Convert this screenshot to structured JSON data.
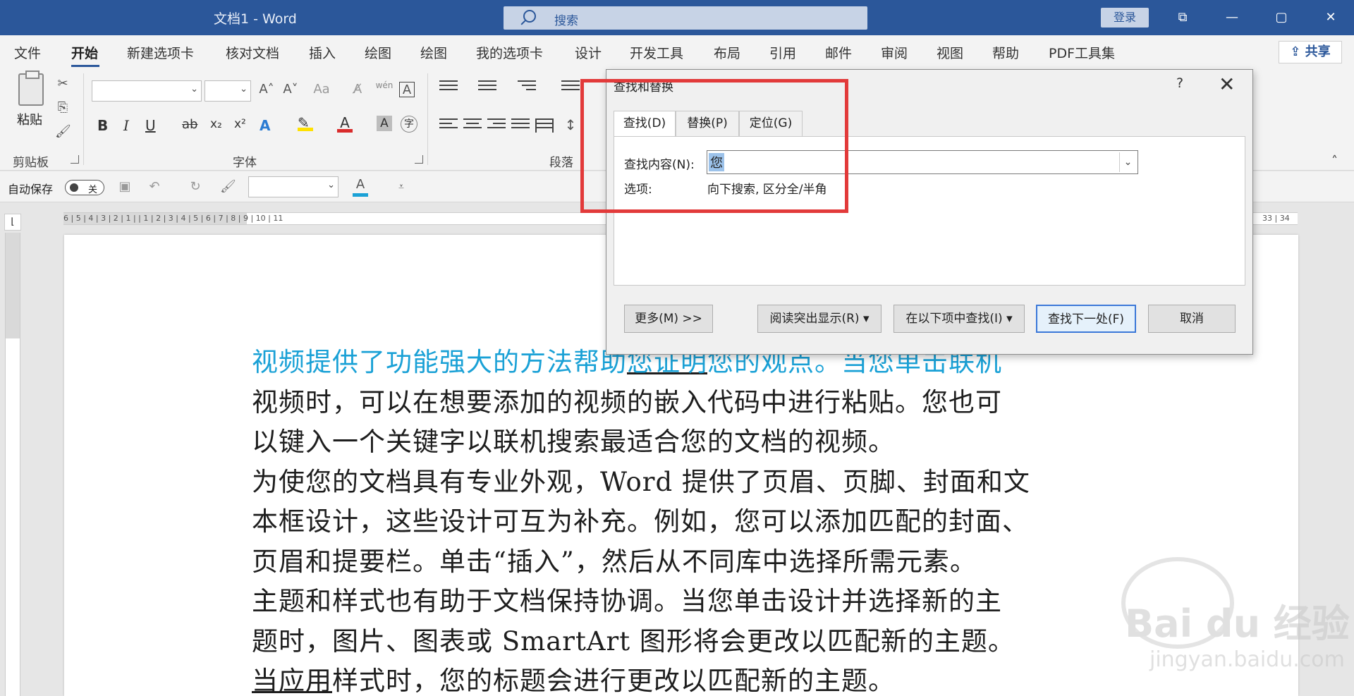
{
  "titlebar": {
    "title": "文档1  -  Word",
    "search_placeholder": "搜索",
    "login": "登录",
    "restore_label": "⧉",
    "minimize_label": "—",
    "maximize_label": "▢",
    "close_label": "✕"
  },
  "menu": {
    "items": [
      "文件",
      "开始",
      "新建选项卡",
      "核对文档",
      "插入",
      "绘图",
      "绘图",
      "我的选项卡",
      "设计",
      "开发工具",
      "布局",
      "引用",
      "邮件",
      "审阅",
      "视图",
      "帮助",
      "PDF工具集"
    ],
    "share": "共享"
  },
  "ribbon": {
    "paste_label": "粘贴",
    "clipboard_label": "剪贴板",
    "font_label": "字体",
    "paragraph_label": "段落",
    "bold": "B",
    "italic": "I",
    "underline": "U",
    "strike": "ab",
    "subscript": "x₂",
    "superscript": "x²",
    "font_color": "A",
    "grow": "A˄",
    "shrink": "A˅",
    "case": "Aa",
    "wen": "wén"
  },
  "qat": {
    "autosave": "自动保存",
    "toggle_state": "关"
  },
  "ruler": {
    "numbers": "6  |  5  |  4  |  3  |  2  |  1  |     |  1  |  2  |  3  |  4  |  5  |  6  |  7  |  8  |  9  |  10  |  11",
    "right_numbers": "33  |  34"
  },
  "dialog": {
    "title": "查找和替换",
    "help": "?",
    "close": "✕",
    "tabs": [
      "查找(D)",
      "替换(P)",
      "定位(G)"
    ],
    "find_label": "查找内容(N):",
    "find_value": "您",
    "options_label": "选项:",
    "options_value": "向下搜索, 区分全/半角",
    "buttons": {
      "more": "更多(M) >>",
      "reading_highlight": "阅读突出显示(R) ▾",
      "find_in": "在以下项中查找(I) ▾",
      "find_next": "查找下一处(F)",
      "cancel": "取消"
    }
  },
  "document": {
    "line1_a": "视频提供了功能强大的方法帮助",
    "line1_b": "您证明",
    "line1_c": "您的观点。当您单击联机",
    "line2": "视频时，可以在想要添加的视频的嵌入代码中进行粘贴。您也可",
    "line3": "以键入一个关键字以联机搜索最适合您的文档的视频。",
    "line4": "为使您的文档具有专业外观，Word 提供了页眉、页脚、封面和文",
    "line5": "本框设计，这些设计可互为补充。例如，您可以添加匹配的封面、",
    "line6": "页眉和提要栏。单击“插入”，然后从不同库中选择所需元素。",
    "line7": "主题和样式也有助于文档保持协调。当您单击设计并选择新的主",
    "line8": "题时，图片、图表或 SmartArt 图形将会更改以匹配新的主题。",
    "line9_a": "当应用",
    "line9_b": "样式时，您的标题会进行更改以匹配新的主题。"
  },
  "watermark": {
    "brand": "Bai du 经验",
    "url": "jingyan.baidu.com"
  },
  "colors": {
    "titlebar": "#2b579a",
    "highlight": "#e23a3a",
    "blue_text": "#1aa1d6"
  }
}
